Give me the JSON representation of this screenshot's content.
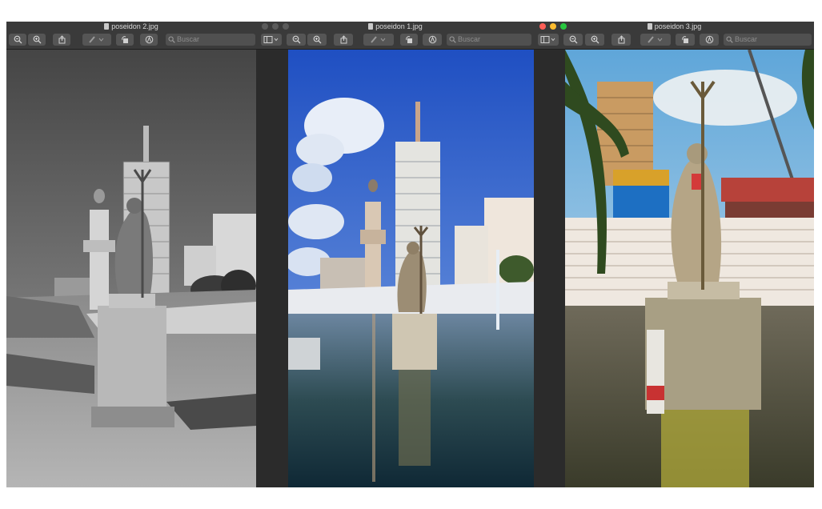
{
  "windows": [
    {
      "title": "poseidon 2.jpg",
      "search_placeholder": "Buscar"
    },
    {
      "title": "poseidon 1.jpg",
      "search_placeholder": "Buscar"
    },
    {
      "title": "poseidon 3.jpg",
      "search_placeholder": "Buscar"
    }
  ],
  "colors": {
    "window_bg": "#2b2b2b",
    "toolbar_bg": "#3a3a3a",
    "close": "#ff5f57",
    "minimize": "#febc2e",
    "zoom": "#28c840",
    "inactive_traffic": "#5a5a5a"
  },
  "icons": [
    "zoom-out-icon",
    "zoom-in-icon",
    "share-icon",
    "pen-icon",
    "rotate-icon",
    "markup-icon",
    "sidebar-icon",
    "search-icon"
  ]
}
